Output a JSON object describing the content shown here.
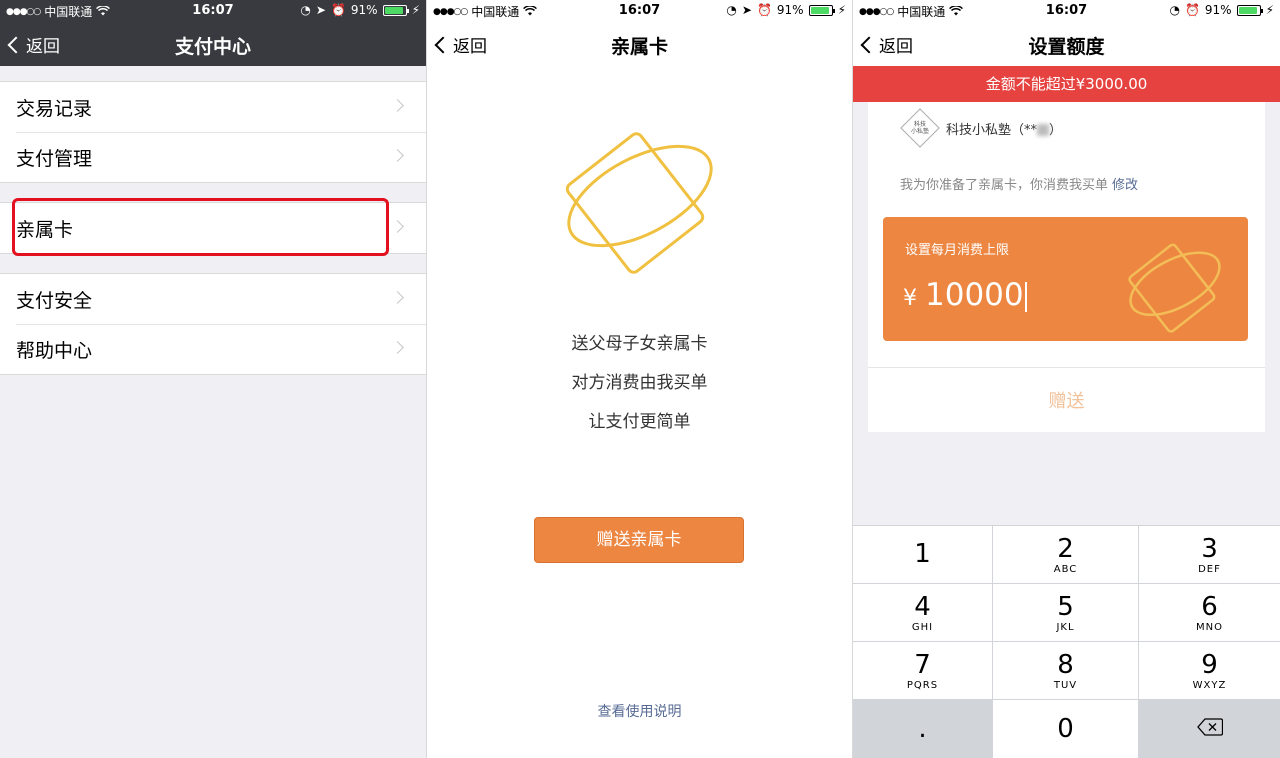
{
  "status_bar": {
    "carrier": "中国联通",
    "time": "16:07",
    "battery": "91%"
  },
  "screen1": {
    "back_label": "返回",
    "title": "支付中心",
    "groups": [
      [
        "交易记录",
        "支付管理"
      ],
      [
        "亲属卡"
      ],
      [
        "支付安全",
        "帮助中心"
      ]
    ]
  },
  "screen2": {
    "back_label": "返回",
    "title": "亲属卡",
    "lines": [
      "送父母子女亲属卡",
      "对方消费由我买单",
      "让支付更简单"
    ],
    "gift_button": "赠送亲属卡",
    "help_link": "查看使用说明",
    "accent_color": "#f0c040"
  },
  "screen3": {
    "back_label": "返回",
    "title": "设置额度",
    "error_message": "金额不能超过¥3000.00",
    "org_logo_text": "科技\n小私塾",
    "recipient_name": "科技小私塾（**",
    "recipient_suffix": "）",
    "note": "我为你准备了亲属卡，你消费我买单",
    "edit_link": "修改",
    "limit_label": "设置每月消费上限",
    "currency_symbol": "¥",
    "amount": "10000",
    "send_button": "赠送",
    "keypad": [
      {
        "num": "1",
        "sub": ""
      },
      {
        "num": "2",
        "sub": "ABC"
      },
      {
        "num": "3",
        "sub": "DEF"
      },
      {
        "num": "4",
        "sub": "GHI"
      },
      {
        "num": "5",
        "sub": "JKL"
      },
      {
        "num": "6",
        "sub": "MNO"
      },
      {
        "num": "7",
        "sub": "PQRS"
      },
      {
        "num": "8",
        "sub": "TUV"
      },
      {
        "num": "9",
        "sub": "WXYZ"
      },
      {
        "num": ".",
        "sub": ""
      },
      {
        "num": "0",
        "sub": ""
      },
      {
        "num": "backspace-icon",
        "sub": ""
      }
    ],
    "colors": {
      "error": "#e64340",
      "card": "#ec8641",
      "link": "#576b95"
    }
  }
}
